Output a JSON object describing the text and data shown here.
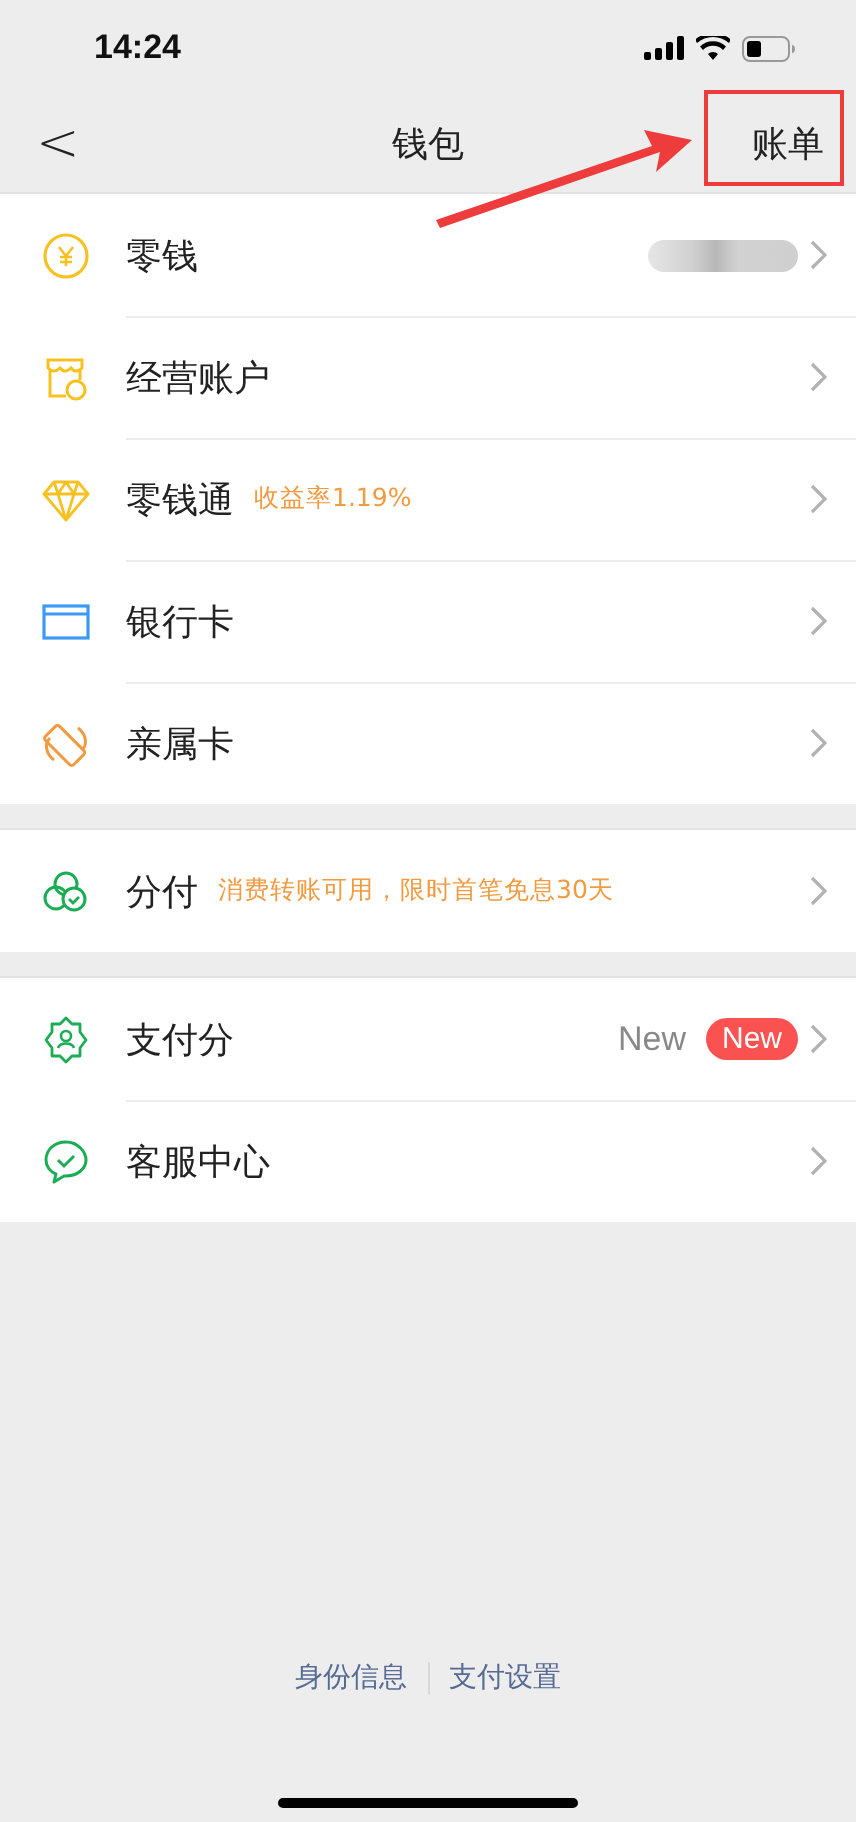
{
  "status_bar": {
    "time": "14:24"
  },
  "nav": {
    "back": "<",
    "title": "钱包",
    "action": "账单",
    "action_highlighted": true
  },
  "sections": [
    {
      "rows": [
        {
          "label": "零钱",
          "masked": true
        },
        {
          "label": "经营账户",
          "masked": false
        },
        {
          "label": "零钱通",
          "note": "收益率1.19%",
          "masked": false
        },
        {
          "label": "银行卡",
          "masked": false
        },
        {
          "label": "亲属卡",
          "masked": false
        }
      ]
    },
    {
      "rows": [
        {
          "label": "分付",
          "note": "消费转账可用，限时首笔免息30天",
          "masked": false
        }
      ]
    },
    {
      "rows": [
        {
          "label": "支付分",
          "value": "New",
          "badge": "New",
          "masked": false
        },
        {
          "label": "客服中心",
          "masked": false
        }
      ]
    }
  ],
  "footer_links": [
    "身份信息",
    "支付设置"
  ]
}
